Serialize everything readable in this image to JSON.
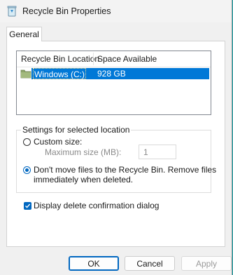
{
  "window": {
    "title": "Recycle Bin Properties"
  },
  "tabs": [
    {
      "label": "General",
      "selected": true
    }
  ],
  "list": {
    "columns": [
      "Recycle Bin Location",
      "Space Available"
    ],
    "rows": [
      {
        "location": "Windows (C:)",
        "space": "928 GB",
        "selected": true,
        "icon": "drive-icon"
      }
    ]
  },
  "settings": {
    "group_label": "Settings for selected location",
    "custom_size": {
      "label": "Custom size:",
      "checked": false
    },
    "max_size": {
      "label": "Maximum size (MB):",
      "value": "1",
      "enabled": false
    },
    "dont_move": {
      "line1": "Don't move files to the Recycle Bin. Remove files",
      "line2": "immediately when deleted.",
      "checked": true
    },
    "confirm_dialog": {
      "label": "Display delete confirmation dialog",
      "checked": true
    }
  },
  "buttons": {
    "ok": "OK",
    "cancel": "Cancel",
    "apply": "Apply"
  },
  "colors": {
    "accent": "#0067c0",
    "selection": "#0078d7",
    "desktop": "#18a2a8"
  }
}
